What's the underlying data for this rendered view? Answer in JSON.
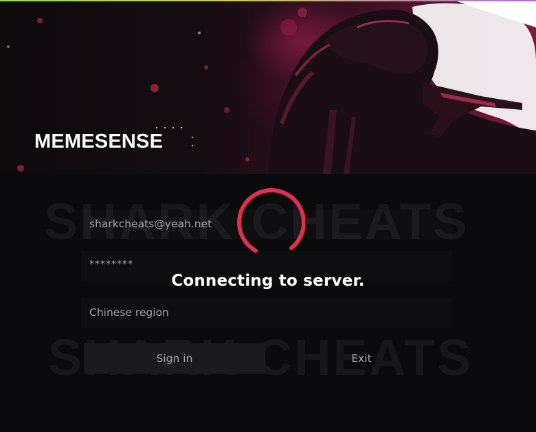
{
  "brand": {
    "title": "MEMESENSE"
  },
  "watermark": {
    "text_top": "SHARK CHEATS",
    "text_bottom": "SHARK CHEATS"
  },
  "login": {
    "email_value": "sharkcheats@yeah.net",
    "password_value": "********",
    "region_value": "Chinese region",
    "signin_label": "Sign in",
    "exit_label": "Exit"
  },
  "overlay": {
    "status_text": "Connecting to server.",
    "spinner_color": "#e0304e"
  },
  "colors": {
    "accent": "#e0304e",
    "background": "#0a0a0d"
  }
}
